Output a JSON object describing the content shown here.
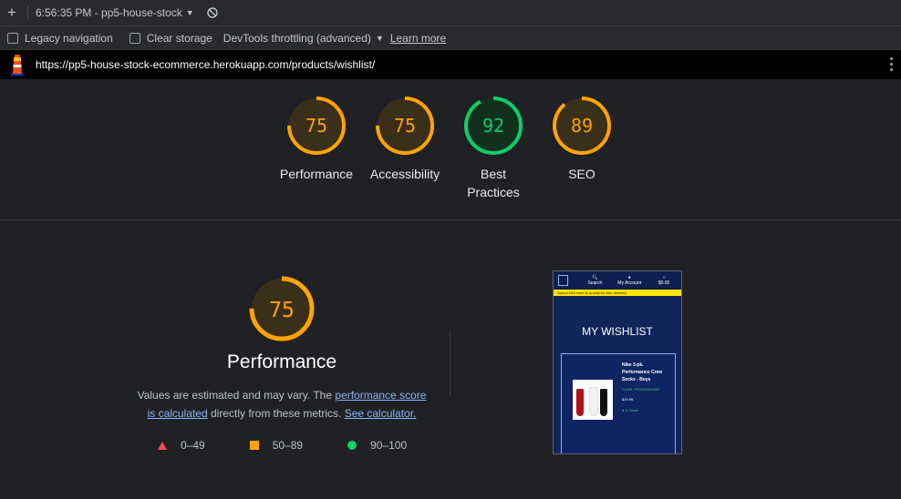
{
  "toolbar": {
    "new_tab_glyph": "+",
    "session": "6:56:35 PM - pp5-house-stock",
    "caret": "▼"
  },
  "options": {
    "legacy_navigation": "Legacy navigation",
    "clear_storage": "Clear storage",
    "throttling": "DevTools throttling (advanced)",
    "caret": "▼",
    "learn_more": "Learn more"
  },
  "url": {
    "text": "https://pp5-house-stock-ecommerce.herokuapp.com/products/wishlist/"
  },
  "scores": [
    {
      "value": "75",
      "label": "Performance",
      "fraction": 0.75,
      "color": "#ffa400"
    },
    {
      "value": "75",
      "label": "Accessibility",
      "fraction": 0.75,
      "color": "#ffa400"
    },
    {
      "value": "92",
      "label": "Best Practices",
      "fraction": 0.92,
      "color": "#0cce6b"
    },
    {
      "value": "89",
      "label": "SEO",
      "fraction": 0.89,
      "color": "#ffa400"
    }
  ],
  "performance": {
    "score": "75",
    "fraction": 0.75,
    "title": "Performance",
    "desc_1": "Values are estimated and may vary. The ",
    "link_1": "performance score is calculated",
    "desc_2": " directly from these metrics. ",
    "link_2": "See calculator."
  },
  "legend": {
    "fail": "0–49",
    "average": "50–89",
    "pass": "90–100"
  },
  "screenshot": {
    "nav_search": "Search",
    "nav_account": "My Account",
    "nav_cart": "$0.00",
    "banner": "Spend £99 more to qualify for free delivery!",
    "heading": "MY WISHLIST",
    "product_name": "Nike 3-pk. Performance Crew Socks - Boys",
    "product_code": "CODE: PP0000020069",
    "product_price": "$19.99",
    "product_stock": "● In Stock"
  },
  "colors": {
    "orange": "#ffa400",
    "green": "#0cce6b",
    "red": "#ff4e42",
    "link": "#8ab4f8"
  }
}
